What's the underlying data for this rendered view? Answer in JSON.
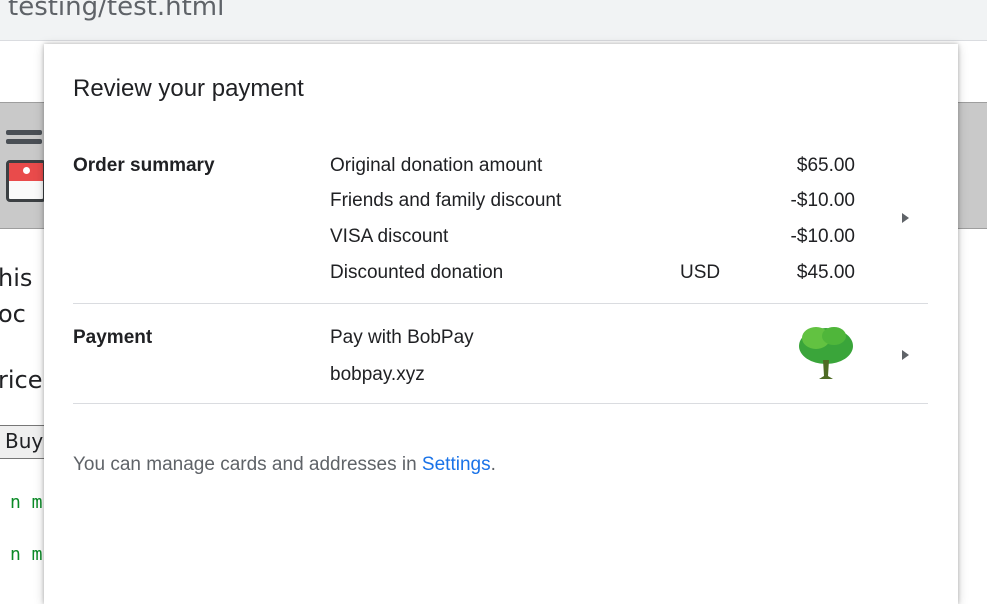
{
  "browser": {
    "url_fragment": "testing/test.html"
  },
  "background_page": {
    "text_lines": [
      "his",
      "oc",
      "rice"
    ],
    "buy_button": "Buy",
    "code_lines": [
      "n m",
      "n m"
    ]
  },
  "dialog": {
    "title": "Review your payment",
    "order_summary": {
      "label": "Order summary",
      "items": [
        {
          "name": "Original donation amount",
          "currency": "",
          "amount": "$65.00"
        },
        {
          "name": "Friends and family discount",
          "currency": "",
          "amount": "-$10.00"
        },
        {
          "name": "VISA discount",
          "currency": "",
          "amount": "-$10.00"
        },
        {
          "name": "Discounted donation",
          "currency": "USD",
          "amount": "$45.00"
        }
      ]
    },
    "payment": {
      "label": "Payment",
      "method": "Pay with BobPay",
      "origin": "bobpay.xyz",
      "icon": "tree-icon"
    },
    "footer": {
      "prefix": "You can manage cards and addresses in ",
      "link": "Settings",
      "suffix": "."
    }
  },
  "colors": {
    "link": "#1a73e8",
    "tree_foliage": "#3aa53a",
    "tree_trunk": "#4e6b24"
  }
}
